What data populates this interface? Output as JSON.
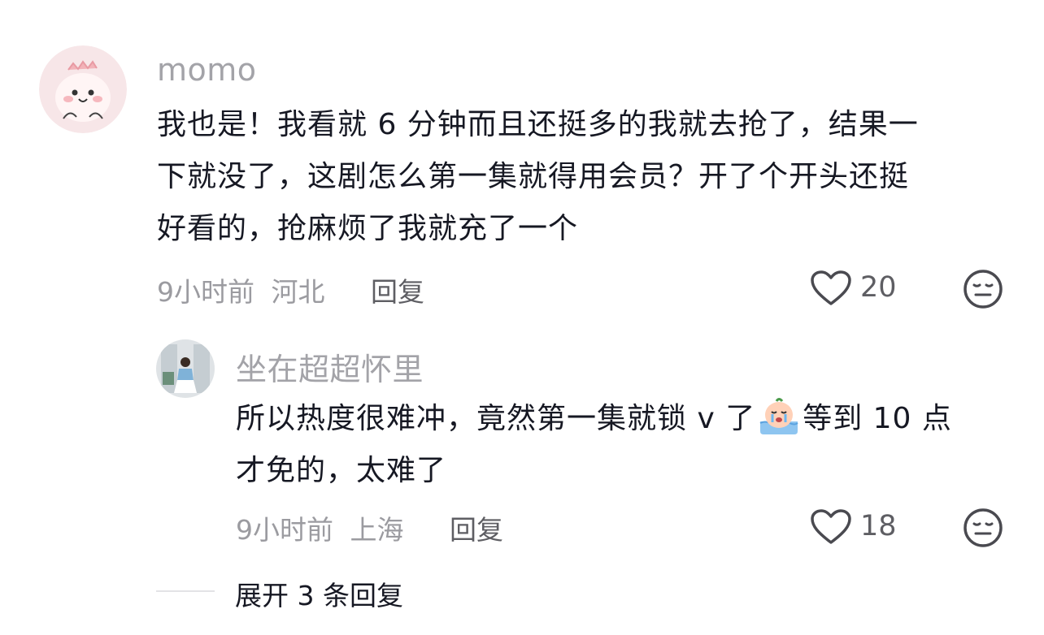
{
  "comments": [
    {
      "username": "momo",
      "content": "我也是！我看就6分钟而且还挺多的我就去抢了，结果一下就没了，这剧怎么第一集就得用会员？开了个开头还挺好看的，抢麻烦了我就充了一个",
      "lines": [
        "我也是！我看就 6 分钟而且还挺多的我就去抢了，结果一",
        "下就没了，这剧怎么第一集就得用会员？开了个开头还挺",
        "好看的，抢麻烦了我就充了一个"
      ],
      "time": "9小时前",
      "location": "河北",
      "reply_label": "回复",
      "likes": "20",
      "icons": {
        "like": "heart-outline-icon",
        "dislike": "meh-face-icon"
      }
    }
  ],
  "replies": [
    {
      "username": "坐在超超怀里",
      "content_line1_before": "所以热度很难冲，竟然第一集就锁 v 了",
      "content_emoji": "crying-face-emoji",
      "content_line1_after": "等到 10 点",
      "content_line2": "才免的，太难了",
      "time": "9小时前",
      "location": "上海",
      "reply_label": "回复",
      "likes": "18",
      "icons": {
        "like": "heart-outline-icon",
        "dislike": "meh-face-icon"
      }
    }
  ],
  "expand_replies_label": "展开 3 条回复",
  "colors": {
    "text": "#161823",
    "secondary": "#a3a3a8",
    "icon": "#4a4a50"
  }
}
